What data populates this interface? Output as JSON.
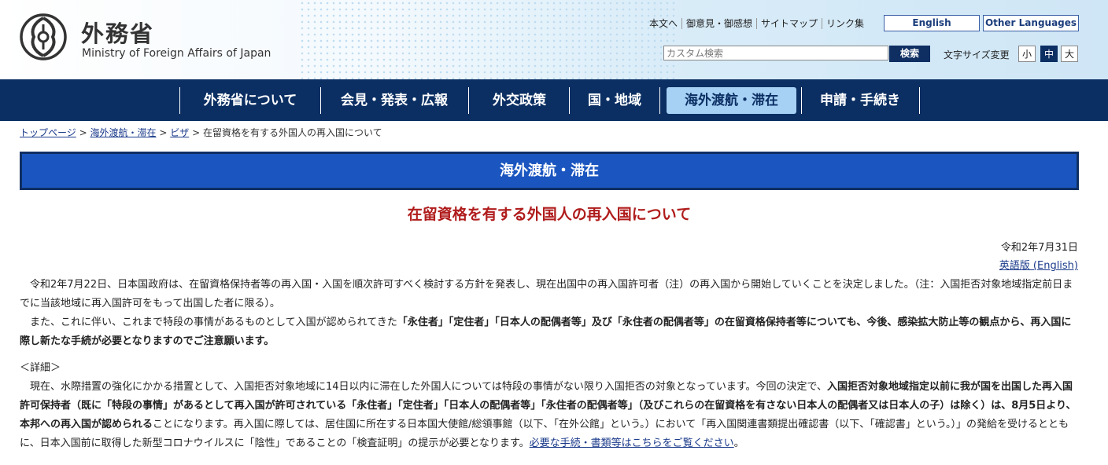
{
  "header": {
    "site_name_ja": "外務省",
    "site_name_en": "Ministry of Foreign Affairs of Japan",
    "util_links": [
      "本文へ",
      "御意見・御感想",
      "サイトマップ",
      "リンク集"
    ],
    "english_button": "English",
    "other_languages_button": "Other Languages",
    "search_placeholder": "カスタム検索",
    "search_button": "検索",
    "font_size_label": "文字サイズ変更",
    "font_sizes": [
      "小",
      "中",
      "大"
    ],
    "active_font_size": "中"
  },
  "nav": {
    "items": [
      "外務省について",
      "会見・発表・広報",
      "外交政策",
      "国・地域",
      "海外渡航・滞在",
      "申請・手続き"
    ],
    "active": "海外渡航・滞在"
  },
  "breadcrumb": {
    "links": [
      "トップページ",
      "海外渡航・滞在",
      "ビザ"
    ],
    "current": "在留資格を有する外国人の再入国について",
    "separator": ">"
  },
  "section_banner": "海外渡航・滞在",
  "page_title": "在留資格を有する外国人の再入国について",
  "date": "令和2年7月31日",
  "english_version_link": "英語版 (English)",
  "body": {
    "p1": "令和2年7月22日、日本国政府は、在留資格保持者等の再入国・入国を順次許可すべく検討する方針を発表し、現在出国中の再入国許可者（注）の再入国から開始していくことを決定しました。（注：入国拒否対象地域指定前日までに当該地域に再入国許可をもって出国した者に限る）。",
    "p2_plain": "また、これに伴い、これまで特段の事情があるものとして入国が認められてきた",
    "p2_bold": "「永住者」「定住者」「日本人の配偶者等」及び「永住者の配偶者等」の在留資格保持者等についても、今後、感染拡大防止等の観点から、再入国に際し新たな手続が必要となりますのでご注意願います。",
    "details_heading": "＜詳細＞",
    "p3_plain1": "現在、水際措置の強化にかかる措置として、入国拒否対象地域に14日以内に滞在した外国人については特段の事情がない限り入国拒否の対象となっています。今回の決定で、",
    "p3_bold": "入国拒否対象地域指定以前に我が国を出国した再入国許可保持者（既に「特段の事情」があるとして再入国が許可されている「永住者」「定住者」「日本人の配偶者等」「永住者の配偶者等」（及びこれらの在留資格を有さない日本人の配偶者又は日本人の子）は除く）は、8月5日より、本邦への再入国が認められる",
    "p3_plain2": "ことになります。再入国に際しては、居住国に所在する日本国大使館/総領事館（以下、「在外公館」という。）において「再入国関連書類提出確認書（以下、「確認書」という。）」の発給を受けるとともに、日本入国前に取得した新型コロナウイルスに「陰性」であることの「検査証明」の提示が必要となります。",
    "p3_link": "必要な手続・書類等はこちらをご覧ください",
    "p3_end": "。"
  },
  "colors": {
    "nav_bg": "#0b2f63",
    "nav_active_bg": "#a6d0f4",
    "banner_bg": "#1b56c0",
    "title_red": "#b01c1c",
    "link_blue": "#1a3a8a"
  }
}
